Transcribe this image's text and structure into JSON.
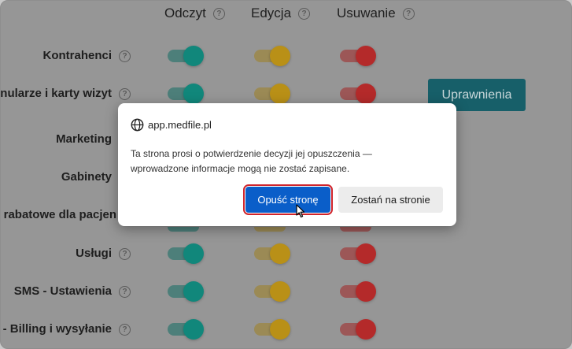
{
  "columns": [
    "Odczyt",
    "Edycja",
    "Usuwanie"
  ],
  "rows": [
    "Kontrahenci",
    "nularze i karty wizyt",
    "Marketing",
    "Gabinety",
    "rabatowe dla pacjen",
    "Usługi",
    "SMS - Ustawienia",
    "- Billing i wysyłanie"
  ],
  "permissions_button": "Uprawnienia",
  "help_symbol": "?",
  "dialog": {
    "site": "app.medfile.pl",
    "message_line1": "Ta strona prosi o potwierdzenie decyzji jej opuszczenia —",
    "message_line2": "wprowadzone informacje mogą nie zostać zapisane.",
    "leave_button": "Opuść stronę",
    "stay_button": "Zostań na stronie"
  },
  "colors": {
    "read_toggle": "#11877b",
    "edit_toggle": "#b99017",
    "delete_toggle": "#b42a2a",
    "primary_button": "#0a5ec9"
  },
  "icons": {
    "globe": "globe-icon",
    "help": "help-circle-icon",
    "cursor": "mouse-pointer-icon"
  }
}
